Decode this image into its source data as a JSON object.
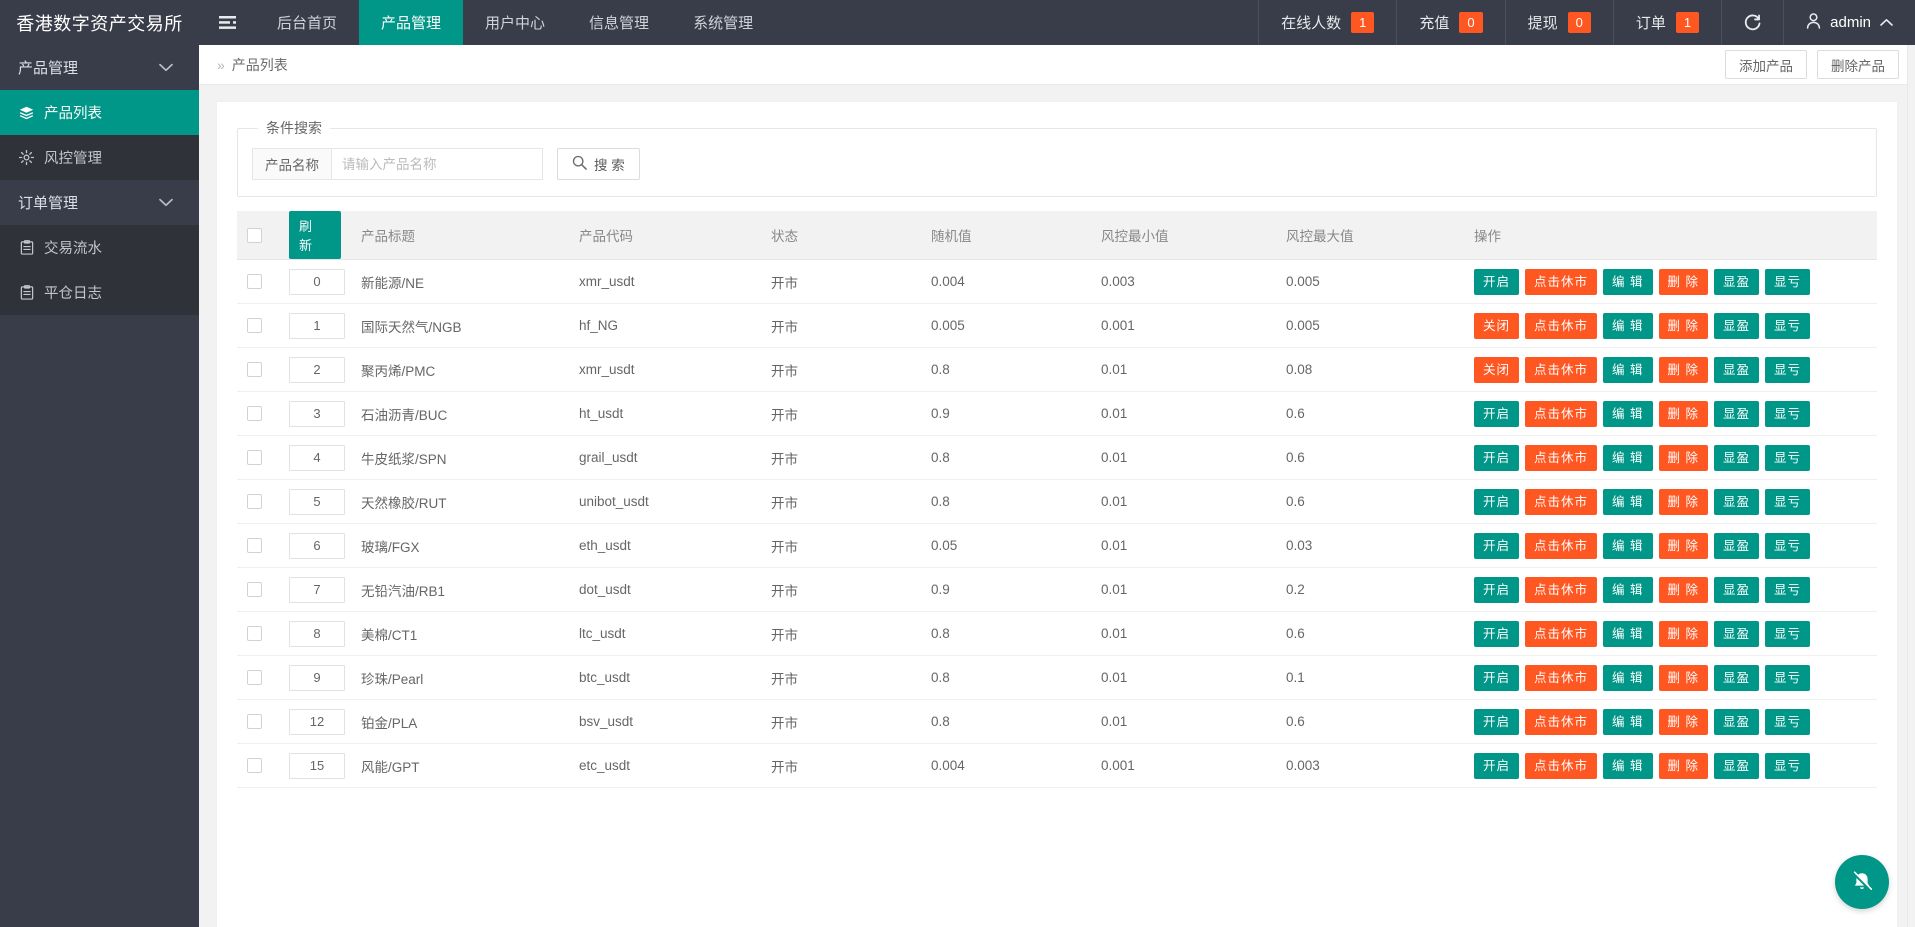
{
  "header": {
    "brand": "香港数字资产交易所",
    "menu_icon": "hamburger-icon",
    "tabs": [
      {
        "label": "后台首页",
        "active": false
      },
      {
        "label": "产品管理",
        "active": true
      },
      {
        "label": "用户中心",
        "active": false
      },
      {
        "label": "信息管理",
        "active": false
      },
      {
        "label": "系统管理",
        "active": false
      }
    ],
    "stats": [
      {
        "label": "在线人数",
        "count": "1"
      },
      {
        "label": "充值",
        "count": "0"
      },
      {
        "label": "提现",
        "count": "0"
      },
      {
        "label": "订单",
        "count": "1"
      }
    ],
    "refresh_icon": "refresh-icon",
    "user": "admin",
    "user_icon": "user-icon",
    "user_chevron": "chevron-up-icon",
    "badge_color": "#FF5722",
    "accent_color": "#009688",
    "bar_color": "#393D49"
  },
  "sidebar": {
    "groups": [
      {
        "label": "产品管理",
        "chevron": "chevron-down-icon",
        "items": [
          {
            "label": "产品列表",
            "icon": "layers-icon",
            "active": true
          },
          {
            "label": "风控管理",
            "icon": "gear-icon",
            "active": false
          }
        ]
      },
      {
        "label": "订单管理",
        "chevron": "chevron-down-icon",
        "items": [
          {
            "label": "交易流水",
            "icon": "clipboard-icon",
            "active": false
          },
          {
            "label": "平仓日志",
            "icon": "clipboard-icon",
            "active": false
          }
        ]
      }
    ]
  },
  "breadcrumb": {
    "arrows": "»",
    "current": "产品列表",
    "actions": [
      {
        "label": "添加产品",
        "name": "add-product-button"
      },
      {
        "label": "删除产品",
        "name": "delete-product-button"
      }
    ]
  },
  "search": {
    "legend": "条件搜索",
    "field_label": "产品名称",
    "placeholder": "请输入产品名称",
    "value": "",
    "button_label": "搜 索",
    "button_icon": "search-icon"
  },
  "table": {
    "refresh_label": "刷 新",
    "select_all_checked": false,
    "columns": [
      "",
      "",
      "产品标题",
      "产品代码",
      "状态",
      "随机值",
      "风控最小值",
      "风控最大值",
      "操作"
    ],
    "headers": {
      "title": "产品标题",
      "code": "产品代码",
      "state": "状态",
      "random": "随机值",
      "min": "风控最小值",
      "max": "风控最大值",
      "ops": "操作"
    },
    "op_labels": {
      "toggle_on": "开启",
      "toggle_off": "关闭",
      "halt": "点击休市",
      "edit": "编 辑",
      "delete": "删 除",
      "profit": "显盈",
      "loss": "显亏"
    },
    "rows": [
      {
        "idx": "0",
        "title": "新能源/NE",
        "code": "xmr_usdt",
        "state": "开市",
        "random": "0.004",
        "min": "0.003",
        "max": "0.005",
        "toggle": "开启"
      },
      {
        "idx": "1",
        "title": "国际天然气/NGB",
        "code": "hf_NG",
        "state": "开市",
        "random": "0.005",
        "min": "0.001",
        "max": "0.005",
        "toggle": "关闭"
      },
      {
        "idx": "2",
        "title": "聚丙烯/PMC",
        "code": "xmr_usdt",
        "state": "开市",
        "random": "0.8",
        "min": "0.01",
        "max": "0.08",
        "toggle": "关闭"
      },
      {
        "idx": "3",
        "title": "石油沥青/BUC",
        "code": "ht_usdt",
        "state": "开市",
        "random": "0.9",
        "min": "0.01",
        "max": "0.6",
        "toggle": "开启"
      },
      {
        "idx": "4",
        "title": "牛皮纸浆/SPN",
        "code": "grail_usdt",
        "state": "开市",
        "random": "0.8",
        "min": "0.01",
        "max": "0.6",
        "toggle": "开启"
      },
      {
        "idx": "5",
        "title": "天然橡胶/RUT",
        "code": "unibot_usdt",
        "state": "开市",
        "random": "0.8",
        "min": "0.01",
        "max": "0.6",
        "toggle": "开启"
      },
      {
        "idx": "6",
        "title": "玻璃/FGX",
        "code": "eth_usdt",
        "state": "开市",
        "random": "0.05",
        "min": "0.01",
        "max": "0.03",
        "toggle": "开启"
      },
      {
        "idx": "7",
        "title": "无铅汽油/RB1",
        "code": "dot_usdt",
        "state": "开市",
        "random": "0.9",
        "min": "0.01",
        "max": "0.2",
        "toggle": "开启"
      },
      {
        "idx": "8",
        "title": "美棉/CT1",
        "code": "ltc_usdt",
        "state": "开市",
        "random": "0.8",
        "min": "0.01",
        "max": "0.6",
        "toggle": "开启"
      },
      {
        "idx": "9",
        "title": "珍珠/Pearl",
        "code": "btc_usdt",
        "state": "开市",
        "random": "0.8",
        "min": "0.01",
        "max": "0.1",
        "toggle": "开启"
      },
      {
        "idx": "12",
        "title": "铂金/PLA",
        "code": "bsv_usdt",
        "state": "开市",
        "random": "0.8",
        "min": "0.01",
        "max": "0.6",
        "toggle": "开启"
      },
      {
        "idx": "15",
        "title": "风能/GPT",
        "code": "etc_usdt",
        "state": "开市",
        "random": "0.004",
        "min": "0.001",
        "max": "0.003",
        "toggle": "开启"
      }
    ]
  },
  "fab": {
    "icon": "bell-muted-icon"
  }
}
